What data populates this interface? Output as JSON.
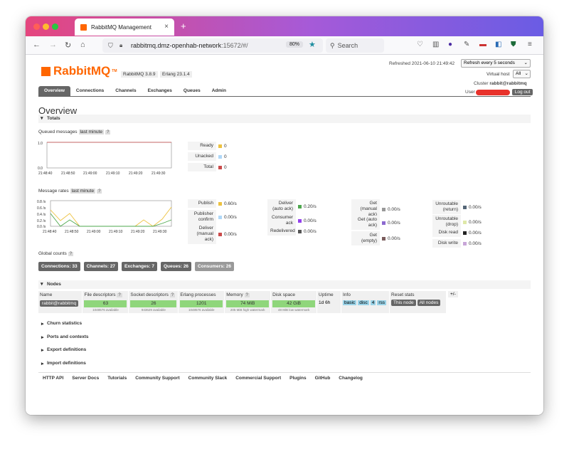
{
  "browser": {
    "tab_title": "RabbitMQ Management",
    "url_domain": "rabbitmq.dmz-openhab-network",
    "url_rest": ":15672/#/",
    "zoom": "80%",
    "search_placeholder": "Search"
  },
  "header": {
    "logo": "RabbitMQ",
    "logo_tm": "TM",
    "rmq_version": "RabbitMQ 3.8.9",
    "erlang_version": "Erlang 23.1.4",
    "refreshed": "Refreshed 2021-06-10 21:49:42",
    "refresh_option": "Refresh every 5 seconds",
    "vhost_label": "Virtual host",
    "vhost_value": "All",
    "cluster_label": "Cluster",
    "cluster_value": "rabbit@rabbitmq",
    "user_label": "User",
    "logout": "Log out"
  },
  "nav": [
    "Overview",
    "Connections",
    "Channels",
    "Exchanges",
    "Queues",
    "Admin"
  ],
  "page_title": "Overview",
  "totals": {
    "heading": "Totals",
    "queued_label": "Queued messages",
    "queued_range": "last minute",
    "help": "?",
    "queued_chart": {
      "y_ticks": [
        "1.0",
        "0.0"
      ],
      "x_ticks": [
        "21:48:40",
        "21:48:50",
        "21:49:00",
        "21:49:10",
        "21:49:20",
        "21:49:30"
      ]
    },
    "queued_legend": [
      {
        "name": "Ready",
        "value": "0",
        "color": "#edc240"
      },
      {
        "name": "Unacked",
        "value": "0",
        "color": "#afd8f8"
      },
      {
        "name": "Total",
        "value": "0",
        "color": "#cb4b4b"
      }
    ],
    "rates_label": "Message rates",
    "rates_range": "last minute",
    "rates_chart": {
      "y_ticks": [
        "0.8 /s",
        "0.6 /s",
        "0.4 /s",
        "0.2 /s",
        "0.0 /s"
      ],
      "x_ticks": [
        "21:48:40",
        "21:48:50",
        "21:49:00",
        "21:49:10",
        "21:49:20",
        "21:49:30"
      ]
    },
    "rates_legend": [
      {
        "name": "Publish",
        "value": "0.60/s",
        "color": "#edc240"
      },
      {
        "name": "Publisher confirm",
        "value": "0.00/s",
        "color": "#afd8f8"
      },
      {
        "name": "Deliver (manual ack)",
        "value": "0.00/s",
        "color": "#cb4b4b"
      },
      {
        "name": "Deliver (auto ack)",
        "value": "0.20/s",
        "color": "#4da74d"
      },
      {
        "name": "Consumer ack",
        "value": "0.00/s",
        "color": "#9440ed"
      },
      {
        "name": "Redelivered",
        "value": "0.00/s",
        "color": "#555555"
      },
      {
        "name": "Get (manual ack)",
        "value": "0.00/s",
        "color": "#999999"
      },
      {
        "name": "Get (auto ack)",
        "value": "0.00/s",
        "color": "#8c69d0"
      },
      {
        "name": "Get (empty)",
        "value": "0.00/s",
        "color": "#7a5c5c"
      },
      {
        "name": "Unroutable (return)",
        "value": "0.00/s",
        "color": "#556677"
      },
      {
        "name": "Unroutable (drop)",
        "value": "0.00/s",
        "color": "#dfe8a8"
      },
      {
        "name": "Disk read",
        "value": "0.00/s",
        "color": "#222222"
      },
      {
        "name": "Disk write",
        "value": "0.00/s",
        "color": "#c8a6d8"
      }
    ],
    "global_label": "Global counts",
    "counts": [
      {
        "label": "Connections:",
        "value": "33"
      },
      {
        "label": "Channels:",
        "value": "27"
      },
      {
        "label": "Exchanges:",
        "value": "7"
      },
      {
        "label": "Queues:",
        "value": "26"
      },
      {
        "label": "Consumers:",
        "value": "26"
      }
    ]
  },
  "nodes": {
    "heading": "Nodes",
    "columns": [
      "Name",
      "File descriptors",
      "Socket descriptors",
      "Erlang processes",
      "Memory",
      "Disk space",
      "Uptime",
      "Info",
      "Reset stats"
    ],
    "plusminus": "+/-",
    "row": {
      "name": "rabbit@rabbitmq",
      "fd": "63",
      "fd_sub": "1048576 available",
      "sd": "26",
      "sd_sub": "943629 available",
      "ep": "1201",
      "ep_sub": "1048576 available",
      "mem": "74 MiB",
      "mem_sub": "205 MiB high watermark",
      "disk": "42 GiB",
      "disk_sub": "48 MiB low watermark",
      "uptime": "1d 6h",
      "info": [
        "basic",
        "disc",
        "4",
        "rss"
      ],
      "reset_this": "This node",
      "reset_all": "All nodes"
    }
  },
  "sections": [
    "Churn statistics",
    "Ports and contexts",
    "Export definitions",
    "Import definitions"
  ],
  "footer": [
    "HTTP API",
    "Server Docs",
    "Tutorials",
    "Community Support",
    "Community Slack",
    "Commercial Support",
    "Plugins",
    "GitHub",
    "Changelog"
  ]
}
